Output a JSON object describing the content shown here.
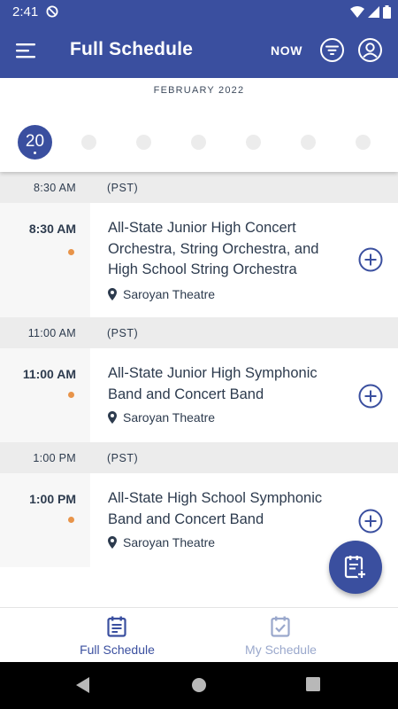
{
  "status_bar": {
    "time": "2:41",
    "icons": [
      "do-not-disturb-icon",
      "wifi-icon",
      "signal-icon",
      "battery-icon"
    ]
  },
  "app_bar": {
    "title": "Full Schedule",
    "now_label": "NOW",
    "icons": [
      "menu-icon",
      "filter-icon",
      "profile-icon"
    ],
    "color": "#3a4f9f"
  },
  "date_strip": {
    "month": "FEBRUARY 2022",
    "selected_day": "20",
    "empty_day_count": 6
  },
  "schedule": [
    {
      "header_time": "8:30 AM",
      "header_zone": "(PST)",
      "event": {
        "time": "8:30 AM",
        "title": "All-State Junior High Concert Orchestra, String Orchestra, and High School String Orchestra",
        "location": "Saroyan Theatre"
      }
    },
    {
      "header_time": "11:00 AM",
      "header_zone": "(PST)",
      "event": {
        "time": "11:00 AM",
        "title": "All-State Junior High Symphonic Band and Concert Band",
        "location": "Saroyan Theatre"
      }
    },
    {
      "header_time": "1:00 PM",
      "header_zone": "(PST)",
      "event": {
        "time": "1:00 PM",
        "title": "All-State High School Symphonic Band and Concert Band",
        "location": "Saroyan Theatre"
      }
    }
  ],
  "bottom_nav": {
    "full_schedule": "Full Schedule",
    "my_schedule": "My Schedule"
  },
  "colors": {
    "primary": "#3a4f9f",
    "accent_dot": "#e8944a",
    "header_bg": "#ececec"
  }
}
